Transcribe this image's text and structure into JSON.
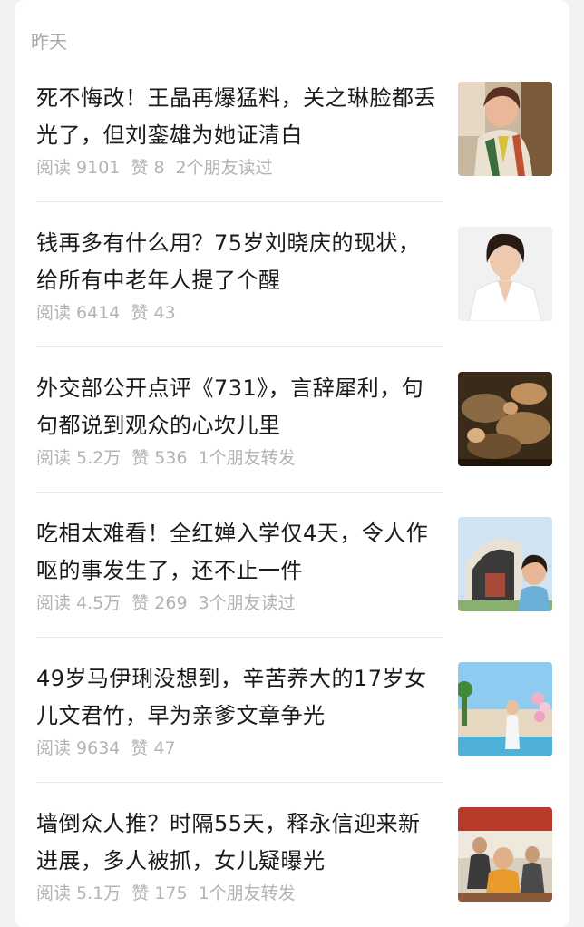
{
  "section_label": "昨天",
  "articles": [
    {
      "title": "死不悔改！王晶再爆猛料，关之琳脸都丢光了，但刘銮雄为她证清白",
      "reads": "阅读 9101",
      "likes": "赞 8",
      "friends": "2个朋友读过"
    },
    {
      "title": "钱再多有什么用？75岁刘晓庆的现状，给所有中老年人提了个醒",
      "reads": "阅读 6414",
      "likes": "赞 43",
      "friends": ""
    },
    {
      "title": "外交部公开点评《731》，言辞犀利，句句都说到观众的心坎儿里",
      "reads": "阅读 5.2万",
      "likes": "赞 536",
      "friends": "1个朋友转发"
    },
    {
      "title": "吃相太难看！全红婵入学仅4天，令人作呕的事发生了，还不止一件",
      "reads": "阅读 4.5万",
      "likes": "赞 269",
      "friends": "3个朋友读过"
    },
    {
      "title": "49岁马伊琍没想到，辛苦养大的17岁女儿文君竹，早为亲爹文章争光",
      "reads": "阅读 9634",
      "likes": "赞 47",
      "friends": ""
    },
    {
      "title": "墙倒众人推？时隔55天，释永信迎来新进展，多人被抓，女儿疑曝光",
      "reads": "阅读 5.1万",
      "likes": "赞 175",
      "friends": "1个朋友转发"
    }
  ]
}
